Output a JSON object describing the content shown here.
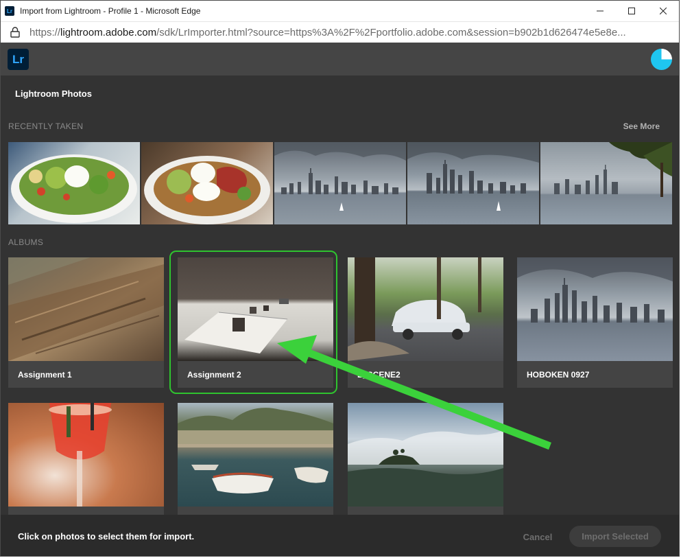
{
  "window": {
    "title": "Import from Lightroom - Profile 1 - Microsoft Edge",
    "app_icon_text": "Lr"
  },
  "address_bar": {
    "url_prefix": "https://",
    "url_host": "lightroom.adobe.com",
    "url_rest": "/sdk/LrImporter.html?source=https%3A%2F%2Fportfolio.adobe.com&session=b902b1d626474e5e8e..."
  },
  "app_header": {
    "logo_text": "Lr"
  },
  "main": {
    "section_title": "Lightroom Photos",
    "recently_taken_label": "RECENTLY TAKEN",
    "see_more_label": "See More",
    "albums_label": "ALBUMS",
    "albums": [
      {
        "name": "Assignment 1"
      },
      {
        "name": "Assignment 2"
      },
      {
        "name": "E_SCENE2"
      },
      {
        "name": "HOBOKEN 0927"
      },
      {
        "name": ""
      },
      {
        "name": ""
      },
      {
        "name": ""
      }
    ]
  },
  "footer": {
    "hint": "Click on photos to select them for import.",
    "cancel_label": "Cancel",
    "import_label": "Import Selected"
  },
  "colors": {
    "highlight": "#2fc42f",
    "arrow": "#3bd13b",
    "lr_blue": "#31a8ff"
  }
}
